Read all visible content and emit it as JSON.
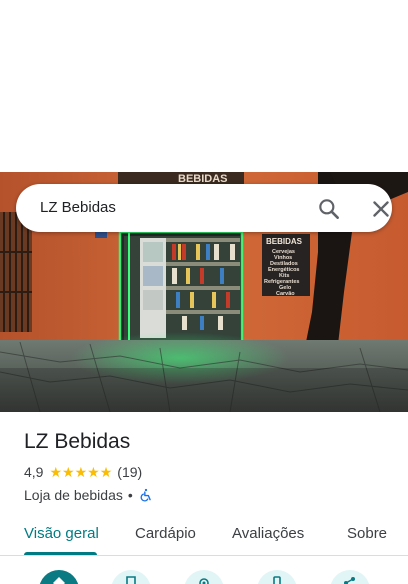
{
  "search": {
    "query": "LZ Bebidas"
  },
  "photo": {
    "sign_top": "BEBIDAS",
    "sign_board_title": "BEBIDAS",
    "sign_board_items": [
      "Cervejas",
      "Vinhos",
      "Destilados",
      "Energéticos",
      "Kits",
      "Refrigerantes",
      "Gelo",
      "Carvão"
    ]
  },
  "place": {
    "name": "LZ Bebidas",
    "rating": "4,9",
    "stars": 5,
    "review_count": "(19)",
    "category": "Loja de bebidas",
    "separator": "•"
  },
  "tabs": [
    {
      "label": "Visão geral",
      "active": true
    },
    {
      "label": "Cardápio",
      "active": false
    },
    {
      "label": "Avaliações",
      "active": false
    },
    {
      "label": "Sobre",
      "active": false
    }
  ],
  "actions": [
    {
      "icon": "directions-icon"
    },
    {
      "icon": "save-icon"
    },
    {
      "icon": "nearby-icon"
    },
    {
      "icon": "phone-icon"
    },
    {
      "icon": "share-icon"
    }
  ],
  "colors": {
    "accent": "#007b83",
    "star": "#fbbc04",
    "wheelchair": "#1a73e8",
    "neon": "#39ff7a"
  }
}
